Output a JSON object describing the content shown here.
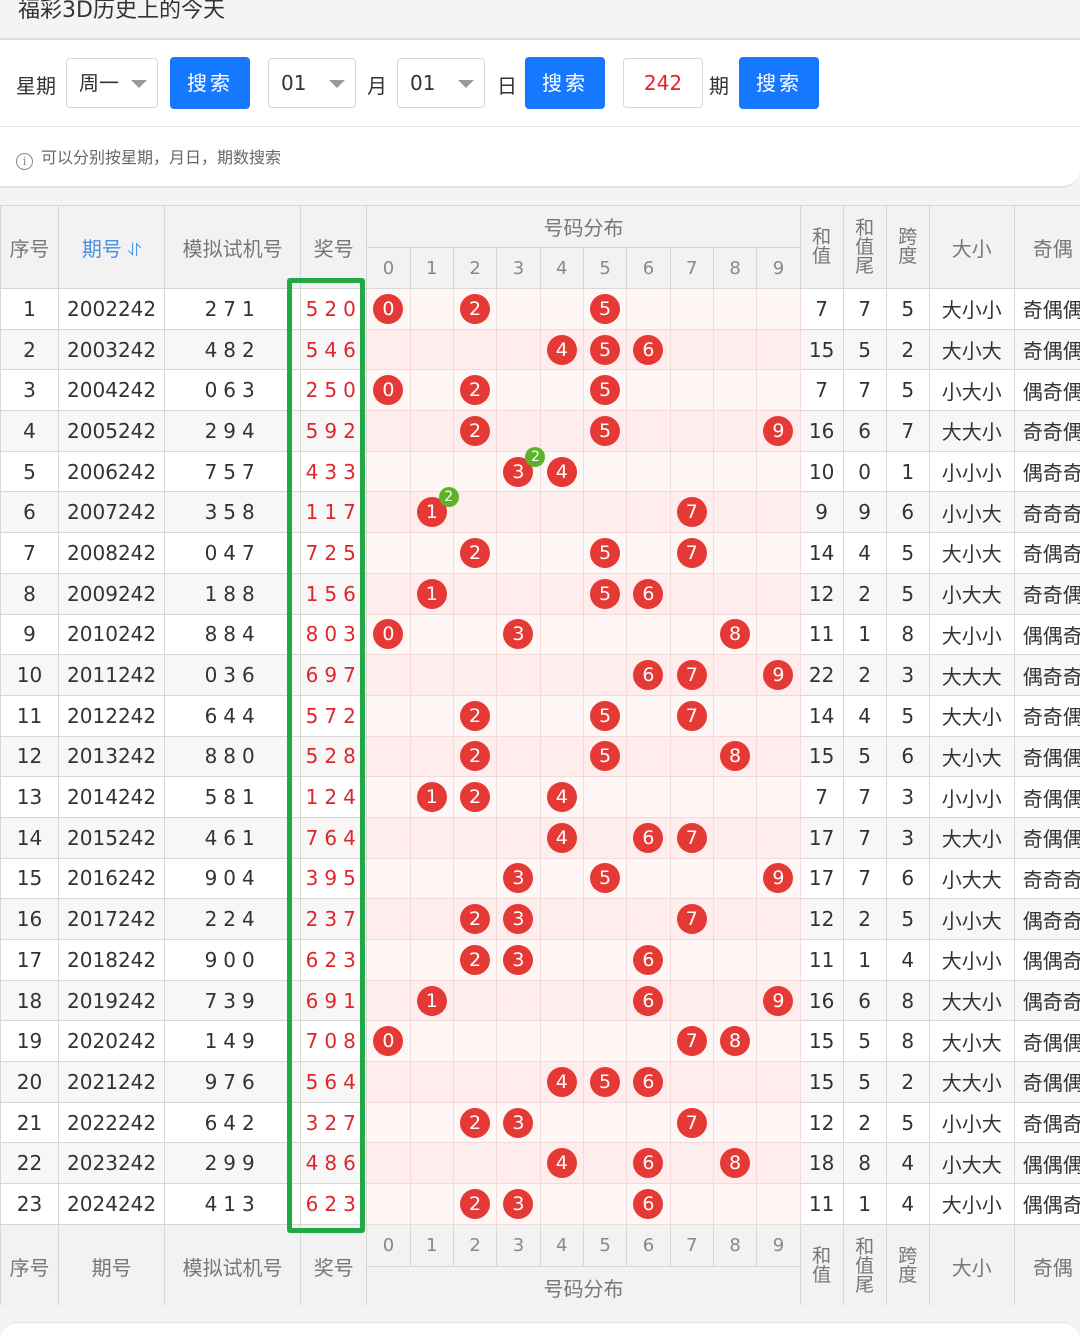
{
  "page_title": "福彩3D历史上的今天",
  "search": {
    "week_label": "星期",
    "week_value": "周一",
    "search_btn": "搜索",
    "month_value": "01",
    "month_label": "月",
    "day_value": "01",
    "day_label": "日",
    "issue_value": "242",
    "issue_label": "期",
    "hint_icon": "i",
    "hint": "可以分别按星期，月日，期数搜索"
  },
  "table": {
    "headers": {
      "index": "序号",
      "issue": "期号",
      "sort_icon": "⥯",
      "trial": "模拟试机号",
      "draw": "奖号",
      "distribution": "号码分布",
      "digits": [
        "0",
        "1",
        "2",
        "3",
        "4",
        "5",
        "6",
        "7",
        "8",
        "9"
      ],
      "sum": "和值",
      "sum_tail": "和值尾",
      "span": "跨度",
      "size": "大小",
      "parity": "奇偶"
    },
    "rows": [
      {
        "idx": "1",
        "issue": "2002242",
        "trial": "271",
        "draw": "520",
        "sum": "7",
        "tail": "7",
        "span": "5",
        "size": "大小小",
        "parity": "奇偶偶"
      },
      {
        "idx": "2",
        "issue": "2003242",
        "trial": "482",
        "draw": "546",
        "sum": "15",
        "tail": "5",
        "span": "2",
        "size": "大小大",
        "parity": "奇偶偶"
      },
      {
        "idx": "3",
        "issue": "2004242",
        "trial": "063",
        "draw": "250",
        "sum": "7",
        "tail": "7",
        "span": "5",
        "size": "小大小",
        "parity": "偶奇偶"
      },
      {
        "idx": "4",
        "issue": "2005242",
        "trial": "294",
        "draw": "592",
        "sum": "16",
        "tail": "6",
        "span": "7",
        "size": "大大小",
        "parity": "奇奇偶"
      },
      {
        "idx": "5",
        "issue": "2006242",
        "trial": "757",
        "draw": "433",
        "sum": "10",
        "tail": "0",
        "span": "1",
        "size": "小小小",
        "parity": "偶奇奇"
      },
      {
        "idx": "6",
        "issue": "2007242",
        "trial": "358",
        "draw": "117",
        "sum": "9",
        "tail": "9",
        "span": "6",
        "size": "小小大",
        "parity": "奇奇奇"
      },
      {
        "idx": "7",
        "issue": "2008242",
        "trial": "047",
        "draw": "725",
        "sum": "14",
        "tail": "4",
        "span": "5",
        "size": "大小大",
        "parity": "奇偶奇"
      },
      {
        "idx": "8",
        "issue": "2009242",
        "trial": "188",
        "draw": "156",
        "sum": "12",
        "tail": "2",
        "span": "5",
        "size": "小大大",
        "parity": "奇奇偶"
      },
      {
        "idx": "9",
        "issue": "2010242",
        "trial": "884",
        "draw": "803",
        "sum": "11",
        "tail": "1",
        "span": "8",
        "size": "大小小",
        "parity": "偶偶奇"
      },
      {
        "idx": "10",
        "issue": "2011242",
        "trial": "036",
        "draw": "697",
        "sum": "22",
        "tail": "2",
        "span": "3",
        "size": "大大大",
        "parity": "偶奇奇"
      },
      {
        "idx": "11",
        "issue": "2012242",
        "trial": "644",
        "draw": "572",
        "sum": "14",
        "tail": "4",
        "span": "5",
        "size": "大大小",
        "parity": "奇奇偶"
      },
      {
        "idx": "12",
        "issue": "2013242",
        "trial": "880",
        "draw": "528",
        "sum": "15",
        "tail": "5",
        "span": "6",
        "size": "大小大",
        "parity": "奇偶偶"
      },
      {
        "idx": "13",
        "issue": "2014242",
        "trial": "581",
        "draw": "124",
        "sum": "7",
        "tail": "7",
        "span": "3",
        "size": "小小小",
        "parity": "奇偶偶"
      },
      {
        "idx": "14",
        "issue": "2015242",
        "trial": "461",
        "draw": "764",
        "sum": "17",
        "tail": "7",
        "span": "3",
        "size": "大大小",
        "parity": "奇偶偶"
      },
      {
        "idx": "15",
        "issue": "2016242",
        "trial": "904",
        "draw": "395",
        "sum": "17",
        "tail": "7",
        "span": "6",
        "size": "小大大",
        "parity": "奇奇奇"
      },
      {
        "idx": "16",
        "issue": "2017242",
        "trial": "224",
        "draw": "237",
        "sum": "12",
        "tail": "2",
        "span": "5",
        "size": "小小大",
        "parity": "偶奇奇"
      },
      {
        "idx": "17",
        "issue": "2018242",
        "trial": "900",
        "draw": "623",
        "sum": "11",
        "tail": "1",
        "span": "4",
        "size": "大小小",
        "parity": "偶偶奇"
      },
      {
        "idx": "18",
        "issue": "2019242",
        "trial": "739",
        "draw": "691",
        "sum": "16",
        "tail": "6",
        "span": "8",
        "size": "大大小",
        "parity": "偶奇奇"
      },
      {
        "idx": "19",
        "issue": "2020242",
        "trial": "149",
        "draw": "708",
        "sum": "15",
        "tail": "5",
        "span": "8",
        "size": "大小大",
        "parity": "奇偶偶"
      },
      {
        "idx": "20",
        "issue": "2021242",
        "trial": "976",
        "draw": "564",
        "sum": "15",
        "tail": "5",
        "span": "2",
        "size": "大大小",
        "parity": "奇偶偶"
      },
      {
        "idx": "21",
        "issue": "2022242",
        "trial": "642",
        "draw": "327",
        "sum": "12",
        "tail": "2",
        "span": "5",
        "size": "小小大",
        "parity": "奇偶奇"
      },
      {
        "idx": "22",
        "issue": "2023242",
        "trial": "299",
        "draw": "486",
        "sum": "18",
        "tail": "8",
        "span": "4",
        "size": "小大大",
        "parity": "偶偶偶"
      },
      {
        "idx": "23",
        "issue": "2024242",
        "trial": "413",
        "draw": "623",
        "sum": "11",
        "tail": "1",
        "span": "4",
        "size": "大小小",
        "parity": "偶偶奇"
      }
    ]
  },
  "colors": {
    "ball": "#e53935",
    "repeat_badge": "#5fb32a",
    "highlight_box": "#22a845",
    "button": "#1677ff"
  }
}
